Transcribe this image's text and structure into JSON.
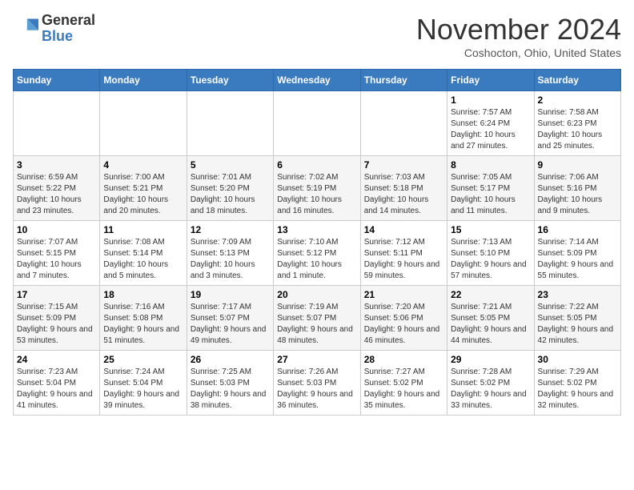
{
  "header": {
    "logo": {
      "line1": "General",
      "line2": "Blue"
    },
    "title": "November 2024",
    "subtitle": "Coshocton, Ohio, United States"
  },
  "days_of_week": [
    "Sunday",
    "Monday",
    "Tuesday",
    "Wednesday",
    "Thursday",
    "Friday",
    "Saturday"
  ],
  "weeks": [
    [
      {
        "day": "",
        "info": ""
      },
      {
        "day": "",
        "info": ""
      },
      {
        "day": "",
        "info": ""
      },
      {
        "day": "",
        "info": ""
      },
      {
        "day": "",
        "info": ""
      },
      {
        "day": "1",
        "info": "Sunrise: 7:57 AM\nSunset: 6:24 PM\nDaylight: 10 hours and 27 minutes."
      },
      {
        "day": "2",
        "info": "Sunrise: 7:58 AM\nSunset: 6:23 PM\nDaylight: 10 hours and 25 minutes."
      }
    ],
    [
      {
        "day": "3",
        "info": "Sunrise: 6:59 AM\nSunset: 5:22 PM\nDaylight: 10 hours and 23 minutes."
      },
      {
        "day": "4",
        "info": "Sunrise: 7:00 AM\nSunset: 5:21 PM\nDaylight: 10 hours and 20 minutes."
      },
      {
        "day": "5",
        "info": "Sunrise: 7:01 AM\nSunset: 5:20 PM\nDaylight: 10 hours and 18 minutes."
      },
      {
        "day": "6",
        "info": "Sunrise: 7:02 AM\nSunset: 5:19 PM\nDaylight: 10 hours and 16 minutes."
      },
      {
        "day": "7",
        "info": "Sunrise: 7:03 AM\nSunset: 5:18 PM\nDaylight: 10 hours and 14 minutes."
      },
      {
        "day": "8",
        "info": "Sunrise: 7:05 AM\nSunset: 5:17 PM\nDaylight: 10 hours and 11 minutes."
      },
      {
        "day": "9",
        "info": "Sunrise: 7:06 AM\nSunset: 5:16 PM\nDaylight: 10 hours and 9 minutes."
      }
    ],
    [
      {
        "day": "10",
        "info": "Sunrise: 7:07 AM\nSunset: 5:15 PM\nDaylight: 10 hours and 7 minutes."
      },
      {
        "day": "11",
        "info": "Sunrise: 7:08 AM\nSunset: 5:14 PM\nDaylight: 10 hours and 5 minutes."
      },
      {
        "day": "12",
        "info": "Sunrise: 7:09 AM\nSunset: 5:13 PM\nDaylight: 10 hours and 3 minutes."
      },
      {
        "day": "13",
        "info": "Sunrise: 7:10 AM\nSunset: 5:12 PM\nDaylight: 10 hours and 1 minute."
      },
      {
        "day": "14",
        "info": "Sunrise: 7:12 AM\nSunset: 5:11 PM\nDaylight: 9 hours and 59 minutes."
      },
      {
        "day": "15",
        "info": "Sunrise: 7:13 AM\nSunset: 5:10 PM\nDaylight: 9 hours and 57 minutes."
      },
      {
        "day": "16",
        "info": "Sunrise: 7:14 AM\nSunset: 5:09 PM\nDaylight: 9 hours and 55 minutes."
      }
    ],
    [
      {
        "day": "17",
        "info": "Sunrise: 7:15 AM\nSunset: 5:09 PM\nDaylight: 9 hours and 53 minutes."
      },
      {
        "day": "18",
        "info": "Sunrise: 7:16 AM\nSunset: 5:08 PM\nDaylight: 9 hours and 51 minutes."
      },
      {
        "day": "19",
        "info": "Sunrise: 7:17 AM\nSunset: 5:07 PM\nDaylight: 9 hours and 49 minutes."
      },
      {
        "day": "20",
        "info": "Sunrise: 7:19 AM\nSunset: 5:07 PM\nDaylight: 9 hours and 48 minutes."
      },
      {
        "day": "21",
        "info": "Sunrise: 7:20 AM\nSunset: 5:06 PM\nDaylight: 9 hours and 46 minutes."
      },
      {
        "day": "22",
        "info": "Sunrise: 7:21 AM\nSunset: 5:05 PM\nDaylight: 9 hours and 44 minutes."
      },
      {
        "day": "23",
        "info": "Sunrise: 7:22 AM\nSunset: 5:05 PM\nDaylight: 9 hours and 42 minutes."
      }
    ],
    [
      {
        "day": "24",
        "info": "Sunrise: 7:23 AM\nSunset: 5:04 PM\nDaylight: 9 hours and 41 minutes."
      },
      {
        "day": "25",
        "info": "Sunrise: 7:24 AM\nSunset: 5:04 PM\nDaylight: 9 hours and 39 minutes."
      },
      {
        "day": "26",
        "info": "Sunrise: 7:25 AM\nSunset: 5:03 PM\nDaylight: 9 hours and 38 minutes."
      },
      {
        "day": "27",
        "info": "Sunrise: 7:26 AM\nSunset: 5:03 PM\nDaylight: 9 hours and 36 minutes."
      },
      {
        "day": "28",
        "info": "Sunrise: 7:27 AM\nSunset: 5:02 PM\nDaylight: 9 hours and 35 minutes."
      },
      {
        "day": "29",
        "info": "Sunrise: 7:28 AM\nSunset: 5:02 PM\nDaylight: 9 hours and 33 minutes."
      },
      {
        "day": "30",
        "info": "Sunrise: 7:29 AM\nSunset: 5:02 PM\nDaylight: 9 hours and 32 minutes."
      }
    ]
  ]
}
